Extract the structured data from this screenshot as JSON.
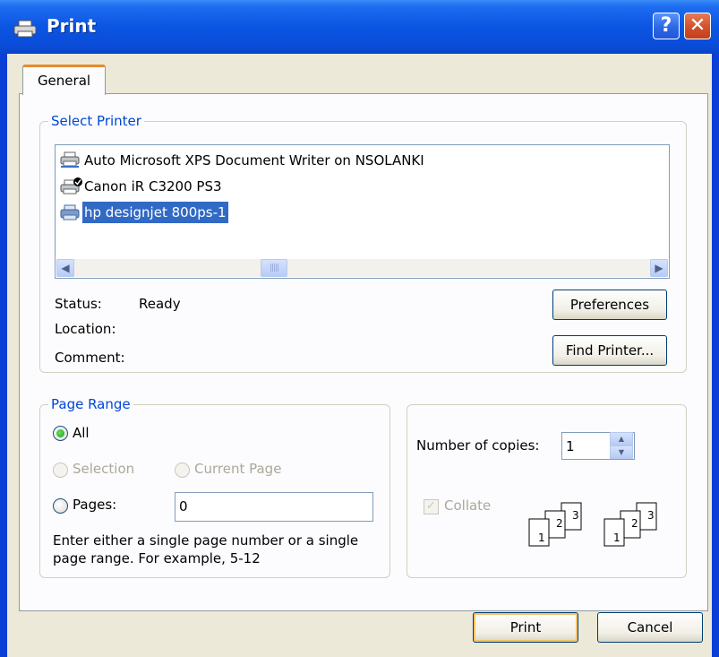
{
  "window": {
    "title": "Print",
    "help_glyph": "?",
    "close_glyph": "✕"
  },
  "tabs": [
    {
      "label": "General",
      "active": true
    }
  ],
  "select_printer": {
    "legend": "Select Printer",
    "printers": [
      {
        "name": "Auto Microsoft XPS Document Writer on NSOLANKI",
        "icon": "printer-network-icon",
        "selected": false
      },
      {
        "name": "Canon iR C3200 PS3",
        "icon": "printer-default-icon",
        "selected": false
      },
      {
        "name": "hp designjet 800ps-1",
        "icon": "printer-icon",
        "selected": true
      }
    ],
    "status_label": "Status:",
    "status_value": "Ready",
    "location_label": "Location:",
    "location_value": "",
    "comment_label": "Comment:",
    "comment_value": "",
    "preferences_button": "Preferences",
    "find_printer_button": "Find Printer..."
  },
  "page_range": {
    "legend": "Page Range",
    "all_label": "All",
    "selection_label": "Selection",
    "current_page_label": "Current Page",
    "pages_label": "Pages:",
    "pages_value": "0",
    "help_text_line1": "Enter either a single page number or a single",
    "help_text_line2": "page range.  For example, 5-12",
    "selected_option": "All"
  },
  "copies": {
    "number_label": "Number of copies:",
    "number_value": "1",
    "collate_label": "Collate",
    "collate_checked": true,
    "collate_enabled": false,
    "collate_pages": [
      "1",
      "2",
      "3"
    ]
  },
  "footer": {
    "print_button": "Print",
    "cancel_button": "Cancel"
  },
  "colors": {
    "titlebar": "#0a55e3",
    "legend": "#0046d5",
    "selection": "#316ac5",
    "dialog_bg": "#ece9d8"
  }
}
